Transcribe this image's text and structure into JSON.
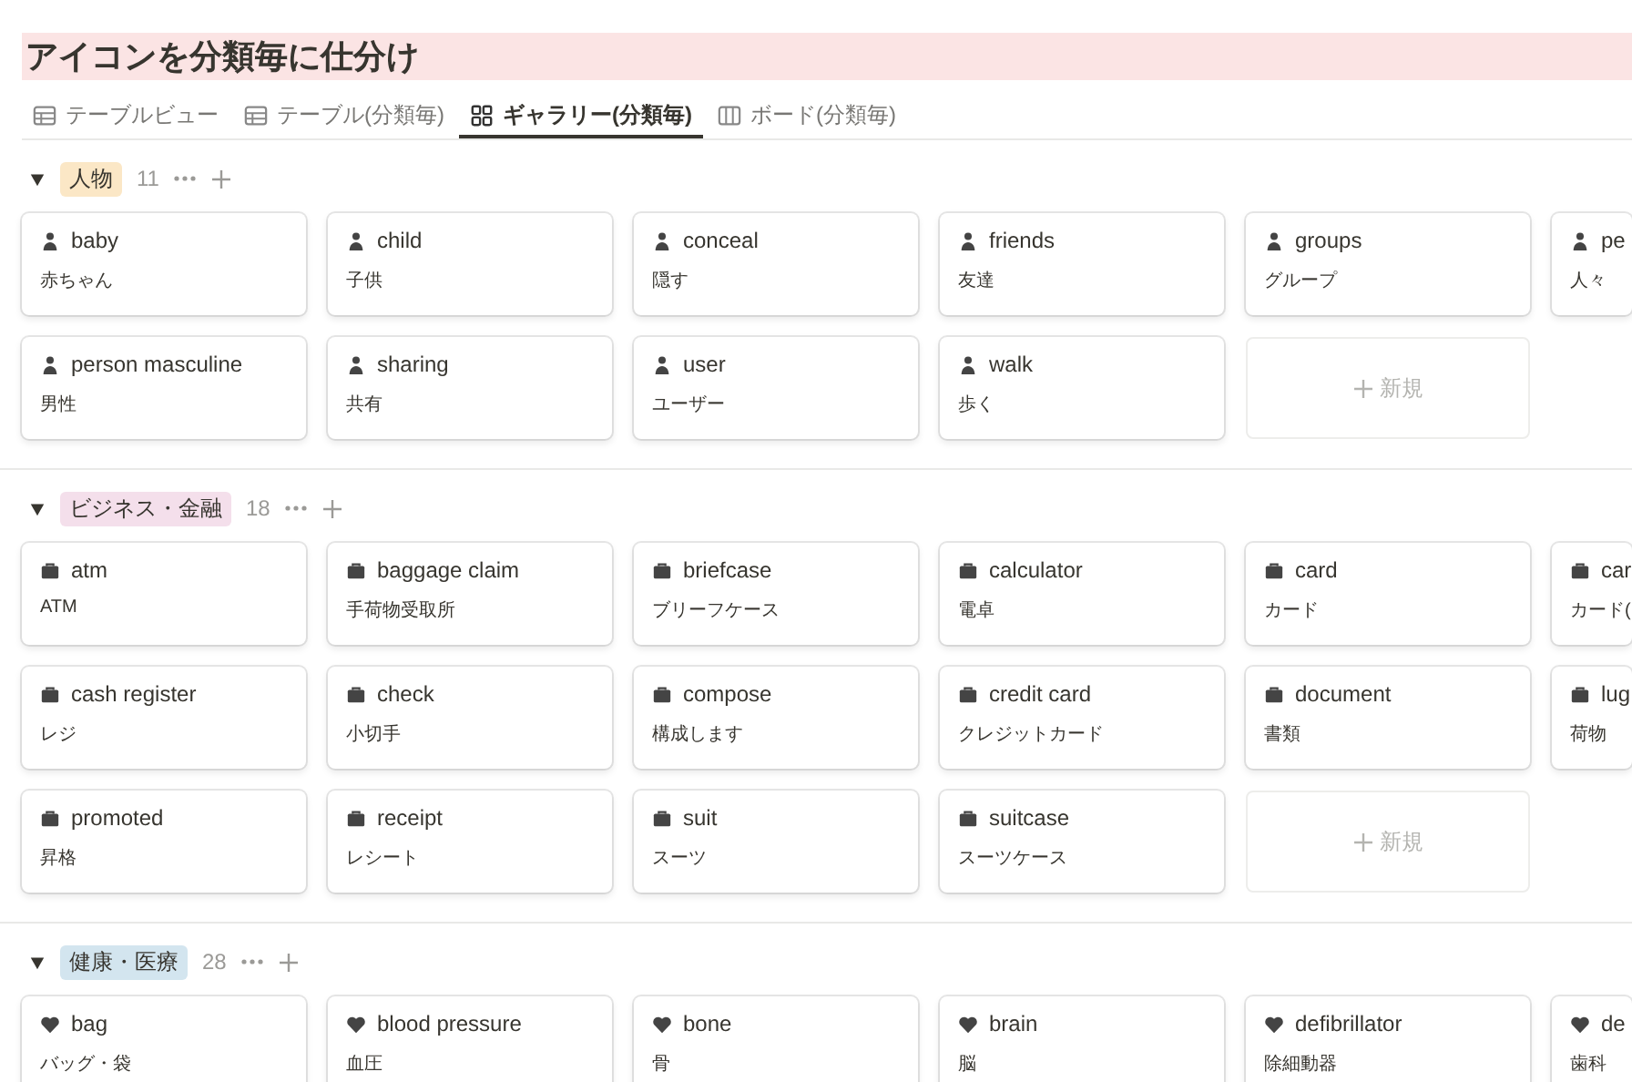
{
  "page": {
    "title": "アイコンを分類毎に仕分け"
  },
  "tabs": [
    {
      "label": "テーブルビュー",
      "kind": "table",
      "selected": false
    },
    {
      "label": "テーブル(分類毎)",
      "kind": "table",
      "selected": false
    },
    {
      "label": "ギャラリー(分類毎)",
      "kind": "gallery",
      "selected": true
    },
    {
      "label": "ボード(分類毎)",
      "kind": "board",
      "selected": false
    }
  ],
  "groups": [
    {
      "name": "人物",
      "color": "#fbe7c6",
      "count": "11",
      "expanded": true,
      "new_label": "新規",
      "rows": [
        [
          {
            "title": "baby",
            "subtitle": "赤ちゃん"
          },
          {
            "title": "child",
            "subtitle": "子供"
          },
          {
            "title": "conceal",
            "subtitle": "隠す"
          },
          {
            "title": "friends",
            "subtitle": "友達"
          },
          {
            "title": "groups",
            "subtitle": "グループ"
          },
          {
            "title": "pe",
            "subtitle": "人々"
          }
        ],
        [
          {
            "title": "person masculine",
            "subtitle": "男性"
          },
          {
            "title": "sharing",
            "subtitle": "共有"
          },
          {
            "title": "user",
            "subtitle": "ユーザー"
          },
          {
            "title": "walk",
            "subtitle": "歩く"
          }
        ]
      ]
    },
    {
      "name": "ビジネス・金融",
      "color": "#f4dfeb",
      "count": "18",
      "expanded": true,
      "new_label": "新規",
      "rows": [
        [
          {
            "title": "atm",
            "subtitle": "ATM"
          },
          {
            "title": "baggage claim",
            "subtitle": "手荷物受取所"
          },
          {
            "title": "briefcase",
            "subtitle": "ブリーフケース"
          },
          {
            "title": "calculator",
            "subtitle": "電卓"
          },
          {
            "title": "card",
            "subtitle": "カード"
          },
          {
            "title": "car",
            "subtitle": "カード("
          }
        ],
        [
          {
            "title": "cash register",
            "subtitle": "レジ"
          },
          {
            "title": "check",
            "subtitle": "小切手"
          },
          {
            "title": "compose",
            "subtitle": "構成します"
          },
          {
            "title": "credit card",
            "subtitle": "クレジットカード"
          },
          {
            "title": "document",
            "subtitle": "書類"
          },
          {
            "title": "lug",
            "subtitle": "荷物"
          }
        ],
        [
          {
            "title": "promoted",
            "subtitle": "昇格"
          },
          {
            "title": "receipt",
            "subtitle": "レシート"
          },
          {
            "title": "suit",
            "subtitle": "スーツ"
          },
          {
            "title": "suitcase",
            "subtitle": "スーツケース"
          }
        ]
      ]
    },
    {
      "name": "健康・医療",
      "color": "#d3e5ef",
      "count": "28",
      "expanded": true,
      "rows": [
        [
          {
            "title": "bag",
            "subtitle": "バッグ・袋"
          },
          {
            "title": "blood pressure",
            "subtitle": "血圧"
          },
          {
            "title": "bone",
            "subtitle": "骨"
          },
          {
            "title": "brain",
            "subtitle": "脳"
          },
          {
            "title": "defibrillator",
            "subtitle": "除細動器"
          },
          {
            "title": "de",
            "subtitle": "歯科"
          }
        ]
      ]
    }
  ]
}
